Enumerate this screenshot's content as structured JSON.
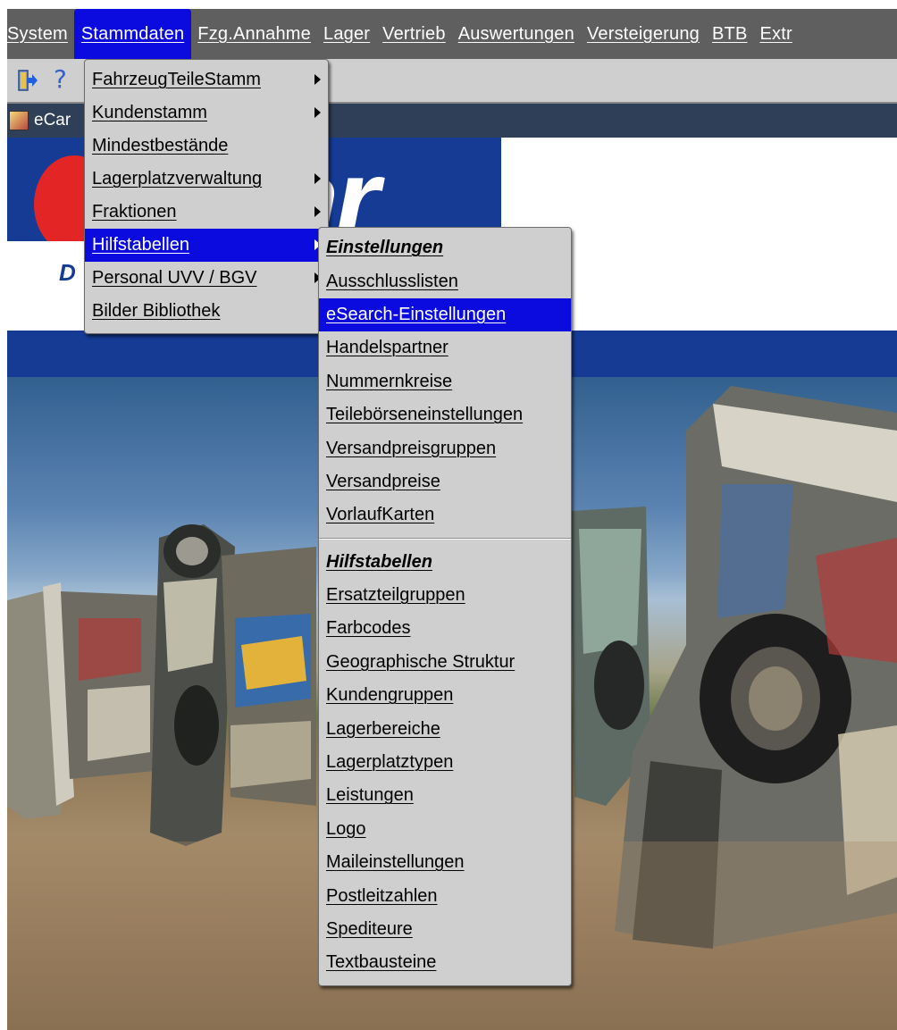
{
  "menubar": {
    "items": [
      {
        "label": "System"
      },
      {
        "label": "Stammdaten"
      },
      {
        "label": "Fzg.Annahme"
      },
      {
        "label": "Lager"
      },
      {
        "label": "Vertrieb"
      },
      {
        "label": "Auswertungen"
      },
      {
        "label": "Versteigerung"
      },
      {
        "label": "BTB"
      },
      {
        "label": "Extr"
      }
    ]
  },
  "toolbar": {
    "help_glyph": "?"
  },
  "frame": {
    "title": "eCar"
  },
  "logo": {
    "mark": "ar",
    "tagline_start": "D"
  },
  "stammdaten_menu": {
    "items": [
      {
        "label": "FahrzeugTeileStamm"
      },
      {
        "label": "Kundenstamm"
      },
      {
        "label": "Mindestbestände"
      },
      {
        "label": "Lagerplatzverwaltung"
      },
      {
        "label": "Fraktionen"
      },
      {
        "label": "Hilfstabellen"
      },
      {
        "label": "Personal UVV / BGV"
      },
      {
        "label": "Bilder Bibliothek"
      }
    ]
  },
  "hilfstabellen_menu": {
    "header_einstellungen": "Einstellungen",
    "einstellungen": [
      {
        "label": "Ausschlusslisten"
      },
      {
        "label": "eSearch-Einstellungen"
      },
      {
        "label": "Handelspartner"
      },
      {
        "label": "Nummernkreise"
      },
      {
        "label": "Teilebörseneinstellungen"
      },
      {
        "label": "Versandpreisgruppen"
      },
      {
        "label": "Versandpreise"
      },
      {
        "label": "VorlaufKarten"
      }
    ],
    "header_hilfstabellen": "Hilfstabellen",
    "hilfstabellen": [
      {
        "label": "Ersatzteilgruppen"
      },
      {
        "label": "Farbcodes"
      },
      {
        "label": "Geographische Struktur"
      },
      {
        "label": "Kundengruppen"
      },
      {
        "label": "Lagerbereiche"
      },
      {
        "label": "Lagerplatztypen"
      },
      {
        "label": "Leistungen"
      },
      {
        "label": "Logo"
      },
      {
        "label": "Maileinstellungen"
      },
      {
        "label": "Postleitzahlen"
      },
      {
        "label": "Spediteure"
      },
      {
        "label": "Textbausteine"
      }
    ]
  },
  "colors": {
    "menubar_bg": "#5f5f5f",
    "selection": "#0b0be0",
    "menu_bg": "#cfcfcf",
    "brand_blue": "#153b95",
    "brand_red": "#e42525"
  },
  "photo": {
    "subject": "spray-painted cars buried nose-down in a desert field"
  }
}
